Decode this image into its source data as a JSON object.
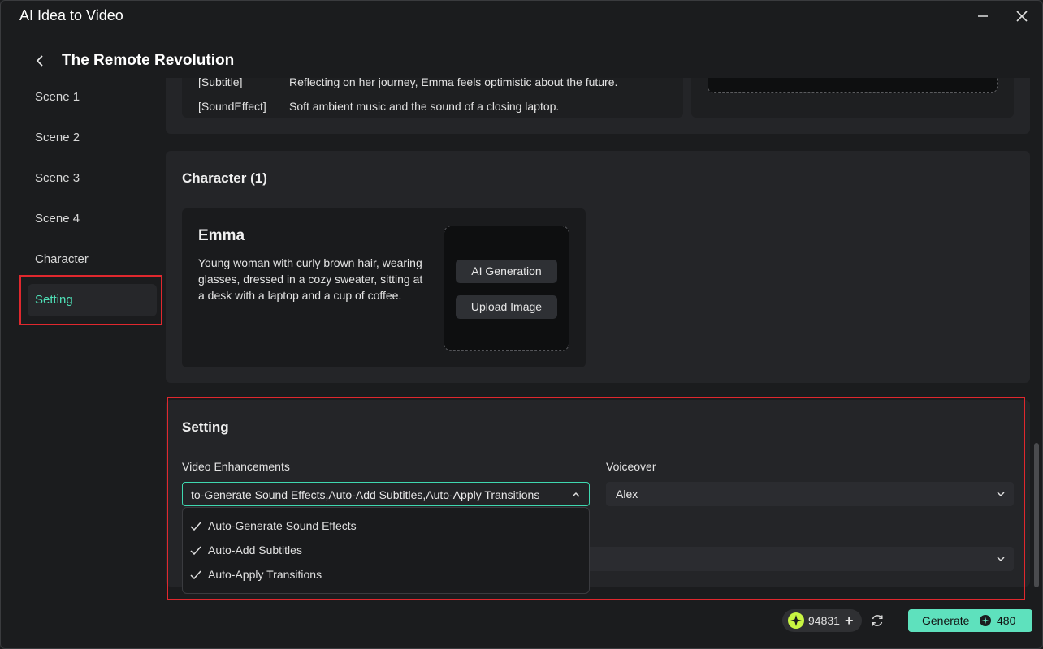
{
  "window": {
    "title": "AI Idea to Video"
  },
  "project": {
    "title": "The Remote Revolution"
  },
  "sidebar": {
    "items": [
      {
        "label": "Scene 1"
      },
      {
        "label": "Scene 2"
      },
      {
        "label": "Scene 3"
      },
      {
        "label": "Scene 4"
      },
      {
        "label": "Character"
      },
      {
        "label": "Setting",
        "active": true
      }
    ]
  },
  "scene4": {
    "rows": [
      {
        "key": "[Subtitle]",
        "value": "Reflecting on her journey, Emma feels optimistic about the future."
      },
      {
        "key": "[SoundEffect]",
        "value": "Soft ambient music and the sound of a closing laptop."
      }
    ]
  },
  "character": {
    "section_title": "Character (1)",
    "name": "Emma",
    "description": "Young woman with curly brown hair, wearing glasses, dressed in a cozy sweater, sitting at a desk with a laptop and a cup of coffee.",
    "ai_generation_label": "AI Generation",
    "upload_image_label": "Upload Image"
  },
  "setting": {
    "section_title": "Setting",
    "video_enhancements_label": "Video Enhancements",
    "video_enhancements_value": "to-Generate Sound Effects,Auto-Add Subtitles,Auto-Apply Transitions",
    "voiceover_label": "Voiceover",
    "voiceover_value": "Alex",
    "dropdown_options": [
      {
        "label": "Auto-Generate Sound Effects",
        "checked": true
      },
      {
        "label": "Auto-Add Subtitles",
        "checked": true
      },
      {
        "label": "Auto-Apply Transitions",
        "checked": true
      }
    ]
  },
  "footer": {
    "credits": "94831",
    "generate_label": "Generate",
    "generate_cost": "480"
  },
  "colors": {
    "accent": "#5ee1bd",
    "active_text": "#4fe0b7",
    "highlight_box": "#e0282e"
  }
}
